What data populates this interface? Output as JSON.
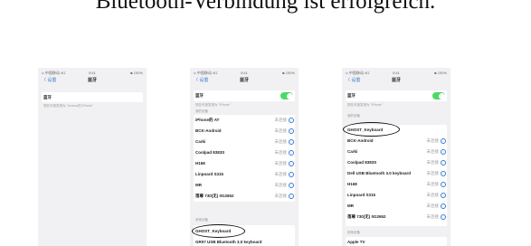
{
  "heading": "Bluetooth-Verbindung ist erfolgreich.",
  "status_bar": {
    "carrier": "•• 中国移动 4G",
    "time": "9:41",
    "battery": "■ 100%"
  },
  "phones": [
    {
      "back": "〈 设置",
      "title": "蓝牙",
      "bt_label": "蓝牙",
      "bt_desc": "现在可被发现为 \"Lenovo的 iPhone\"",
      "section": "",
      "devices": [],
      "other_section": "",
      "other_devices": []
    },
    {
      "back": "〈 设置",
      "title": "蓝牙",
      "bt_label": "蓝牙",
      "bt_desc": "现在可被发现为 \"iPhone\"",
      "section": "我的设备",
      "devices": [
        {
          "name": "iPhone的 AT",
          "status": "未连接"
        },
        {
          "name": "BCK-Android",
          "status": "未连接"
        },
        {
          "name": "Carki",
          "status": "未连接"
        },
        {
          "name": "Coolpad 8383S",
          "status": "未连接"
        },
        {
          "name": "H168",
          "status": "未连接"
        },
        {
          "name": "Linpoard S315",
          "status": "未连接"
        },
        {
          "name": "MR",
          "status": "未连接"
        },
        {
          "name": "落尊 730(无) 0G2652",
          "status": "未连接"
        }
      ],
      "other_section": "其他设备",
      "other_devices": [
        "GHOST_Keyboard",
        "GR07 USB Bluetooth 3.0 keyboard"
      ]
    },
    {
      "back": "〈 设置",
      "title": "蓝牙",
      "bt_label": "蓝牙",
      "bt_desc": "现在可被发现为 \"iPhone\"",
      "section": "我的设备",
      "devices": [
        {
          "name": "GHOST_Keyboard",
          "status": ""
        },
        {
          "name": "BCK-Android",
          "status": "未连接"
        },
        {
          "name": "Carki",
          "status": "未连接"
        },
        {
          "name": "Coolpad 8383S",
          "status": "未连接"
        },
        {
          "name": "Dell USB Bluetooth 3.0 keyboard",
          "status": "未连接"
        },
        {
          "name": "H168",
          "status": "未连接"
        },
        {
          "name": "Linpoard S315",
          "status": "未连接"
        },
        {
          "name": "MR",
          "status": "未连接"
        },
        {
          "name": "落尊 730(无) 0G2652",
          "status": "未连接"
        }
      ],
      "other_section": "其他设备",
      "other_devices": [
        "Apple TV"
      ]
    }
  ]
}
